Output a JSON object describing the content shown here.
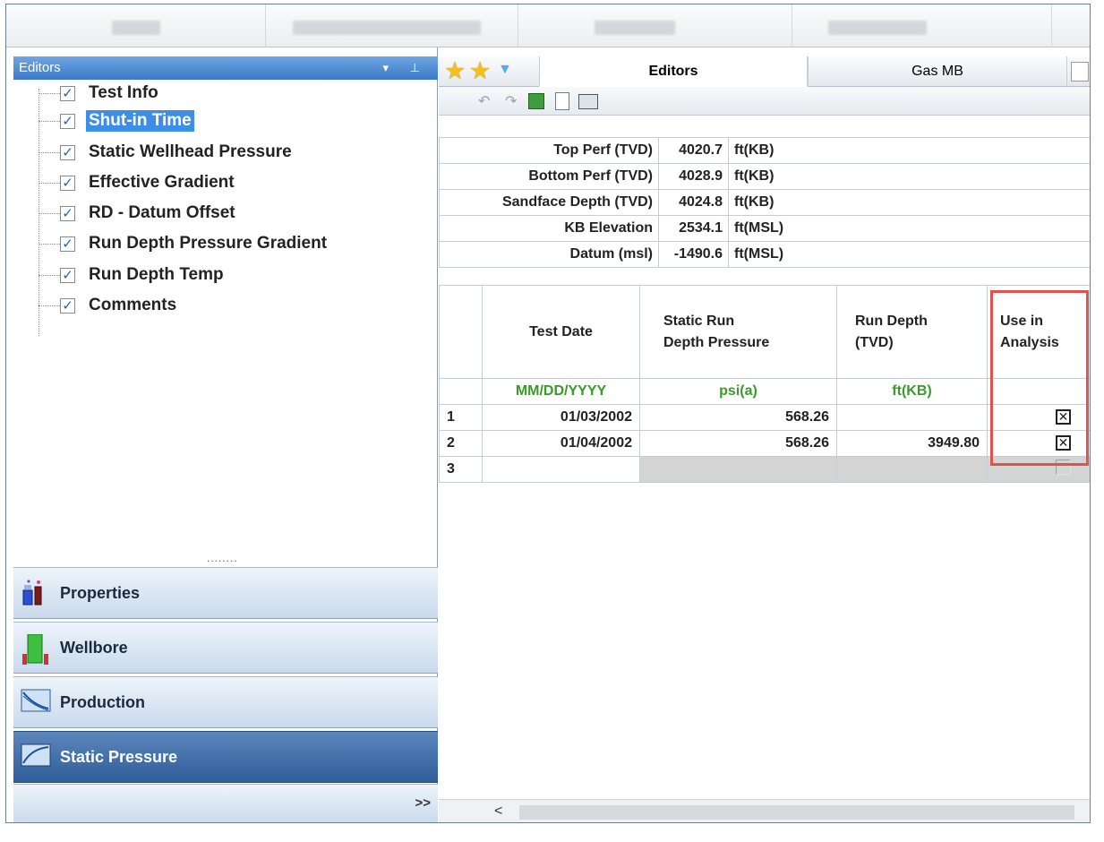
{
  "left_panel": {
    "header": "Editors",
    "header_icons": "▾ ⊥",
    "tree_items": [
      {
        "label": "Test Info",
        "checked": true,
        "selected": false
      },
      {
        "label": "Shut-in Time",
        "checked": true,
        "selected": true
      },
      {
        "label": "Static Wellhead Pressure",
        "checked": true,
        "selected": false
      },
      {
        "label": "Effective Gradient",
        "checked": true,
        "selected": false
      },
      {
        "label": "RD - Datum Offset",
        "checked": true,
        "selected": false
      },
      {
        "label": "Run Depth Pressure Gradient",
        "checked": true,
        "selected": false
      },
      {
        "label": "Run Depth Temp",
        "checked": true,
        "selected": false
      },
      {
        "label": "Comments",
        "checked": true,
        "selected": false
      }
    ],
    "checkmark": "✓",
    "splitter": "........",
    "nav": [
      {
        "label": "Properties",
        "icon": "flasks-icon",
        "active": false
      },
      {
        "label": "Wellbore",
        "icon": "wellbore-icon",
        "active": false
      },
      {
        "label": "Production",
        "icon": "production-chart-icon",
        "active": false
      },
      {
        "label": "Static Pressure",
        "icon": "pressure-chart-icon",
        "active": true
      }
    ],
    "more": ">>"
  },
  "right_panel": {
    "tabs": [
      {
        "label": "Editors",
        "active": true
      },
      {
        "label": "Gas MB",
        "active": false
      }
    ],
    "toolbar": [
      "undo-icon",
      "redo-icon",
      "excel-export-icon",
      "print-preview-icon",
      "print-icon"
    ],
    "well_info": [
      {
        "label": "Top Perf (TVD)",
        "value": "4020.7",
        "unit": "ft(KB)"
      },
      {
        "label": "Bottom Perf (TVD)",
        "value": "4028.9",
        "unit": "ft(KB)"
      },
      {
        "label": "Sandface Depth (TVD)",
        "value": "4024.8",
        "unit": "ft(KB)"
      },
      {
        "label": "KB Elevation",
        "value": "2534.1",
        "unit": "ft(MSL)"
      },
      {
        "label": "Datum (msl)",
        "value": "-1490.6",
        "unit": "ft(MSL)"
      }
    ],
    "grid": {
      "columns": [
        {
          "line1": "Test Date",
          "line2": "",
          "unit": "MM/DD/YYYY"
        },
        {
          "line1": "Static Run",
          "line2": "Depth Pressure",
          "unit": "psi(a)"
        },
        {
          "line1": "Run Depth",
          "line2": "(TVD)",
          "unit": "ft(KB)"
        },
        {
          "line1": "Use in",
          "line2": "Analysis",
          "unit": ""
        }
      ],
      "rows": [
        {
          "num": "1",
          "date": "01/03/2002",
          "pressure": "568.26",
          "depth": "",
          "use": true
        },
        {
          "num": "2",
          "date": "01/04/2002",
          "pressure": "568.26",
          "depth": "3949.80",
          "use": true
        },
        {
          "num": "3",
          "date": "",
          "pressure": "",
          "depth": "",
          "use": false
        }
      ],
      "checked_mark": "✕"
    },
    "scroll_left": "<"
  },
  "colors": {
    "accent": "#3d8ee6",
    "highlight_box": "#e0514f",
    "unit_text": "#3a9a2a"
  }
}
